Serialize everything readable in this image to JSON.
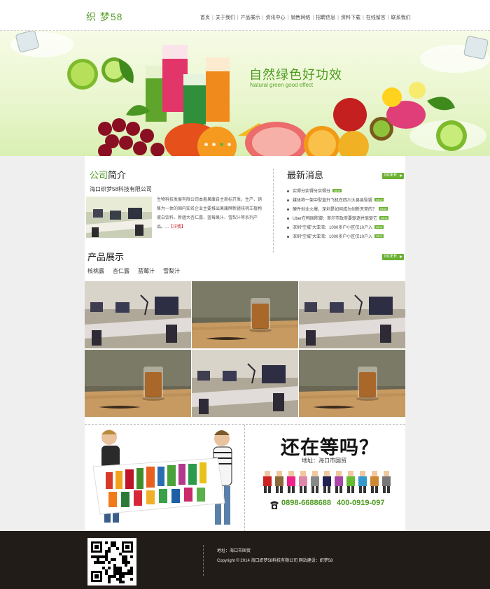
{
  "header": {
    "logo": "织 梦58",
    "nav": [
      "首页",
      "关于我们",
      "产品展示",
      "资讯中心",
      "销售网络",
      "招聘信息",
      "资料下载",
      "在线留言",
      "联系我们"
    ]
  },
  "banner": {
    "title": "自然绿色好功效",
    "subtitle": "Natural green good effect",
    "dots": 4,
    "active_dot": 2
  },
  "about": {
    "title_highlight": "公司",
    "title_rest": "简介",
    "company": "海口织梦58科技有限公司",
    "text": "生物科技发展有限公司本着果康自主商标开发。生产、销售为一体的国内知名企业主要推出果康牌新疆核桃王植物蛋白饮料、新疆大杏仁露、蓝莓果汁、雪梨汁等系列产品。...",
    "more_link": "【详情】"
  },
  "news": {
    "title": "最新消息",
    "more": "MOER",
    "badge": "NEW",
    "items": [
      "实得分实得分实得分",
      "媒体称一架中型直升飞机在四川大县县坠毁",
      "硬件创业火爆，深圳是如何成为创新天堂的？",
      "Uber在韩国陈御：首尔市政府要驱逐并驱驱它",
      "深圳“空城”大亚湾：1000多户小区仅10户入",
      "深圳“空城”大亚湾：1000多户小区仅10户入"
    ]
  },
  "products": {
    "title": "产品展示",
    "more": "MOER",
    "tabs": [
      "核桃露",
      "杏仁露",
      "蓝莓汁",
      "雪梨汁"
    ],
    "images": [
      "office",
      "drink",
      "office",
      "drink",
      "office",
      "drink"
    ]
  },
  "promo": {
    "headline": "还在等吗？",
    "address": "地址：海口市国贸",
    "phone1": "0898-6688688",
    "phone2": "400-0919-097"
  },
  "footer": {
    "address": "地址：海口市国贸",
    "copyright": "Copyright © 2014 海口织梦58科技有限公司    网站建设：织梦58"
  }
}
